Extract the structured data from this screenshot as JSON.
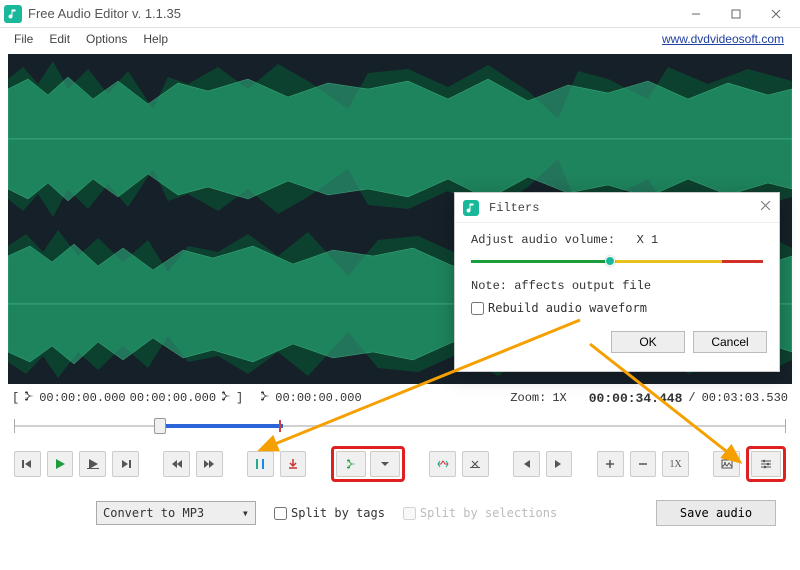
{
  "window": {
    "title": "Free Audio Editor v. 1.1.35",
    "link": "www.dvdvideosoft.com"
  },
  "menu": {
    "file": "File",
    "edit": "Edit",
    "options": "Options",
    "help": "Help"
  },
  "time": {
    "sel_start": "00:00:00.000",
    "sel_end": "00:00:00.000",
    "cursor": "00:00:00.000",
    "zoom_label": "Zoom:",
    "zoom_val": "1X",
    "current": "00:00:34.448",
    "sep": "/",
    "total": "00:03:03.530"
  },
  "toolbar": {
    "one_x": "1X"
  },
  "bottom": {
    "convert": "Convert to MP3",
    "split_tags": "Split by tags",
    "split_sel": "Split by selections",
    "save": "Save audio"
  },
  "dialog": {
    "title": "Filters",
    "vol_label": "Adjust audio volume:",
    "vol_value": "X 1",
    "note": "Note: affects output file",
    "rebuild": "Rebuild audio waveform",
    "ok": "OK",
    "cancel": "Cancel"
  }
}
